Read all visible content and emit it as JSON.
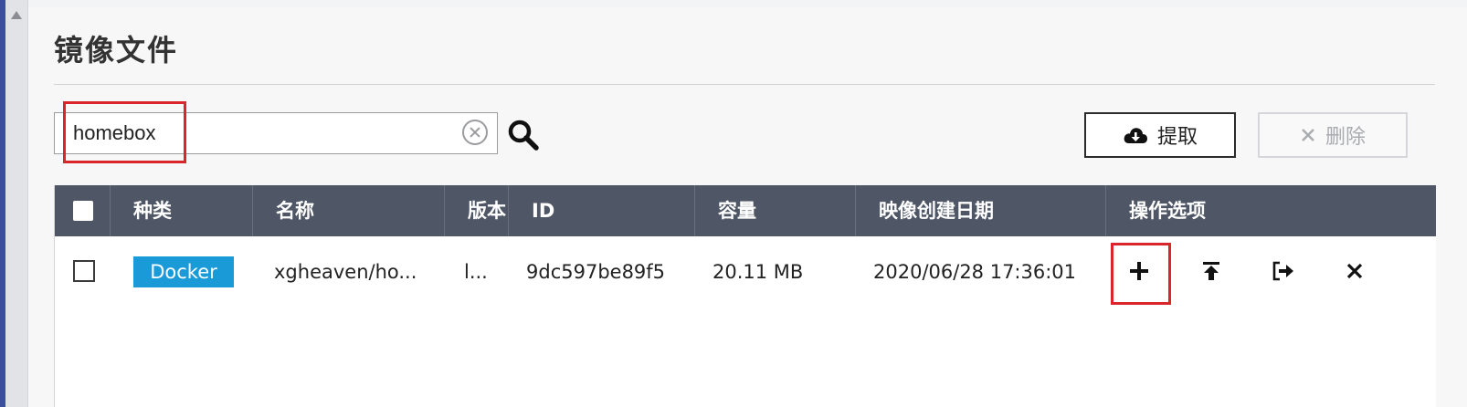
{
  "page": {
    "title": "镜像文件"
  },
  "search": {
    "value": "homebox",
    "placeholder": ""
  },
  "toolbar": {
    "fetch_label": "提取",
    "delete_label": "删除"
  },
  "table": {
    "columns": [
      "种类",
      "名称",
      "版本",
      "ID",
      "容量",
      "映像创建日期",
      "操作选项"
    ],
    "rows": [
      {
        "type": "Docker",
        "name": "xgheaven/ho...",
        "version": "l...",
        "id": "9dc597be89f5",
        "size": "20.11 MB",
        "created": "2020/06/28 17:36:01",
        "actions": [
          "plus-icon",
          "upload-icon",
          "export-icon",
          "close-icon"
        ]
      }
    ]
  },
  "colors": {
    "header_bg": "#4f5766",
    "docker_badge": "#1a9bd7",
    "highlight": "#d9262b"
  }
}
